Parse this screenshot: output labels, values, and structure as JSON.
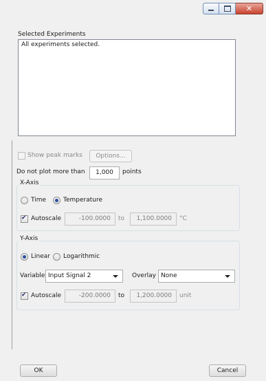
{
  "window": {
    "controls": {
      "minimize_icon": "minimize-icon",
      "maximize_icon": "maximize-icon",
      "close_glyph": "✕"
    }
  },
  "experiments": {
    "title": "Selected Experiments",
    "list_text": "All experiments selected."
  },
  "peak_marks": {
    "label": "Show peak marks",
    "checked": false,
    "options_label": "Options..."
  },
  "plot_limit": {
    "prefix": "Do not plot more than",
    "value": "1,000",
    "suffix": "points"
  },
  "x_axis": {
    "title": "X-Axis",
    "radio_time": "Time",
    "radio_temperature": "Temperature",
    "selected": "Temperature",
    "autoscale_label": "Autoscale",
    "min": "-100.0000",
    "to": "to",
    "max": "1,100.0000",
    "unit": "°C"
  },
  "y_axis": {
    "title": "Y-Axis",
    "radio_linear": "Linear",
    "radio_log": "Logarithmic",
    "selected": "Linear",
    "variable_label": "Variable",
    "variable_value": "Input Signal 2",
    "overlay_label": "Overlay",
    "overlay_value": "None",
    "autoscale_label": "Autoscale",
    "min": "-200.0000",
    "to": "to",
    "max": "1,200.0000",
    "unit": "unit"
  },
  "footer": {
    "ok_label": "OK",
    "cancel_label": "Cancel"
  }
}
